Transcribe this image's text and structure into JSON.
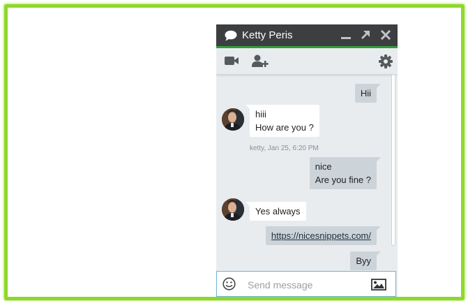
{
  "chat": {
    "title": "Ketty Peris",
    "composer_placeholder": "Send message",
    "messages": [
      {
        "dir": "out",
        "lines": [
          "Hii"
        ]
      },
      {
        "dir": "in",
        "lines": [
          "hiii",
          "How are you ?"
        ],
        "meta": "ketty, Jan 25, 6:20 PM"
      },
      {
        "dir": "out",
        "lines": [
          "nice",
          "Are you fine ?"
        ]
      },
      {
        "dir": "in",
        "lines": [
          "Yes always"
        ]
      },
      {
        "dir": "out",
        "link": "https://nicesnippets.com/"
      },
      {
        "dir": "out",
        "lines": [
          "Byy"
        ]
      }
    ]
  },
  "colors": {
    "frame_border": "#8ed82c",
    "header_bg": "#3c3e40",
    "header_accent": "#2f9e3a",
    "panel_bg": "#e9ecef",
    "outgoing_bubble": "#ccd3d9",
    "incoming_bubble": "#ffffff",
    "composer_border": "#6fb3d8"
  },
  "icons": [
    "chat-bubble-icon",
    "minimize-icon",
    "expand-icon",
    "close-icon",
    "video-camera-icon",
    "add-user-icon",
    "gear-icon",
    "emoji-icon",
    "image-icon"
  ]
}
